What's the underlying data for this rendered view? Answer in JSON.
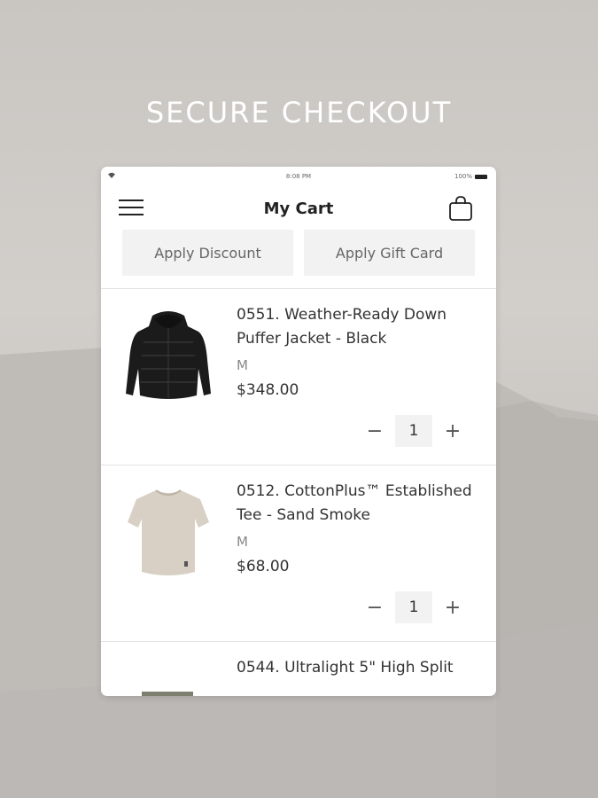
{
  "promo": {
    "headline": "SECURE CHECKOUT"
  },
  "statusbar": {
    "time": "8:08 PM",
    "battery": "100%"
  },
  "navbar": {
    "title": "My Cart"
  },
  "actions": {
    "discount_label": "Apply Discount",
    "giftcard_label": "Apply Gift Card"
  },
  "cart": {
    "items": [
      {
        "name": "0551. Weather-Ready Down Puffer Jacket - Black",
        "size": "M",
        "price": "$348.00",
        "quantity": "1"
      },
      {
        "name": "0512. CottonPlus™ Established Tee - Sand Smoke",
        "size": "M",
        "price": "$68.00",
        "quantity": "1"
      },
      {
        "name": "0544. Ultralight 5\" High Split"
      }
    ]
  },
  "icons": {
    "menu": "hamburger-menu-icon",
    "bag": "shopping-bag-icon",
    "minus": "minus-icon",
    "plus": "plus-icon",
    "wifi": "wifi-icon",
    "battery": "battery-icon"
  },
  "colors": {
    "background": "#cbc8c4",
    "card": "#ffffff",
    "button_bg": "#f2f2f2",
    "text": "#333333",
    "muted": "#888888"
  }
}
